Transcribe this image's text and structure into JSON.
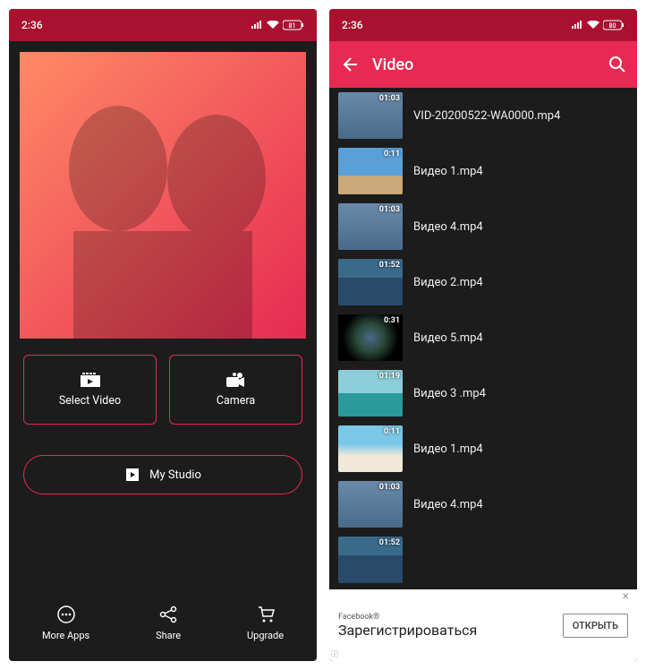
{
  "accent": "#e62a52",
  "left": {
    "status": {
      "time": "2:36",
      "battery": "81"
    },
    "buttons": {
      "select_video": "Select Video",
      "camera": "Camera",
      "my_studio": "My Studio"
    },
    "bottom": {
      "more_apps": "More Apps",
      "share": "Share",
      "upgrade": "Upgrade"
    }
  },
  "right": {
    "status": {
      "time": "2:36",
      "battery": "80"
    },
    "appbar_title": "Video",
    "videos": [
      {
        "dur": "01:03",
        "name": "VID-20200522-WA0000.mp4",
        "thumb": "city"
      },
      {
        "dur": "0:11",
        "name": "Видео 1.mp4",
        "thumb": "sky"
      },
      {
        "dur": "01:03",
        "name": "Видео 4.mp4",
        "thumb": "city"
      },
      {
        "dur": "01:52",
        "name": "Видео 2.mp4",
        "thumb": "ocean"
      },
      {
        "dur": "0:31",
        "name": "Видео 5.mp4",
        "thumb": "earth"
      },
      {
        "dur": "01:19",
        "name": "Видео 3 .mp4",
        "thumb": "sea"
      },
      {
        "dur": "0:11",
        "name": "Видео 1.mp4",
        "thumb": "beach"
      },
      {
        "dur": "01:03",
        "name": "Видео 4.mp4",
        "thumb": "city"
      },
      {
        "dur": "01:52",
        "name": "",
        "thumb": "ocean"
      }
    ],
    "ad": {
      "fb": "Facebook®",
      "text": "Зарегистрироваться",
      "btn": "ОТКРЫТЬ",
      "info": "ⓘ"
    }
  }
}
